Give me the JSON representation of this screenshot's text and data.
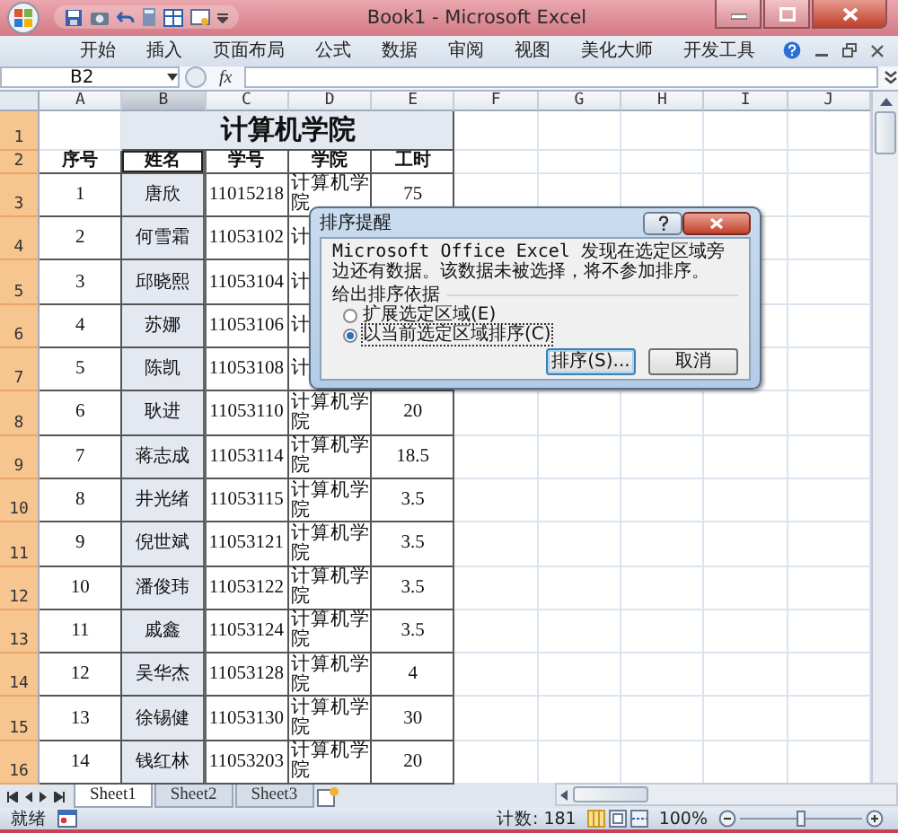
{
  "window": {
    "title": "Book1 - Microsoft Excel"
  },
  "ribbon_tabs": [
    "开始",
    "插入",
    "页面布局",
    "公式",
    "数据",
    "审阅",
    "视图",
    "美化大师",
    "开发工具"
  ],
  "formula_bar": {
    "name_box": "B2",
    "fx": "fx"
  },
  "columns": [
    {
      "label": "A",
      "selected": false
    },
    {
      "label": "B",
      "selected": true
    },
    {
      "label": "C",
      "selected": false
    },
    {
      "label": "D",
      "selected": false
    },
    {
      "label": "E",
      "selected": false
    },
    {
      "label": "F",
      "selected": false
    },
    {
      "label": "G",
      "selected": false
    },
    {
      "label": "H",
      "selected": false
    },
    {
      "label": "I",
      "selected": false
    },
    {
      "label": "J",
      "selected": false
    }
  ],
  "rows": [
    {
      "header": "1",
      "selected": true,
      "kind": "title",
      "cells": [
        "计算机学院"
      ]
    },
    {
      "header": "2",
      "selected": true,
      "kind": "header",
      "cells": [
        "序号",
        "姓名",
        "学号",
        "学院",
        "工时"
      ]
    },
    {
      "header": "3",
      "selected": true,
      "kind": "data",
      "cells": [
        "1",
        "唐欣",
        "11015218",
        "计算机学院",
        "75"
      ]
    },
    {
      "header": "4",
      "selected": true,
      "kind": "data",
      "cells": [
        "2",
        "何雪霜",
        "11053102",
        "计"
      ]
    },
    {
      "header": "5",
      "selected": true,
      "kind": "data",
      "cells": [
        "3",
        "邱晓熙",
        "11053104",
        "计"
      ]
    },
    {
      "header": "6",
      "selected": true,
      "kind": "data",
      "cells": [
        "4",
        "苏娜",
        "11053106",
        "计"
      ]
    },
    {
      "header": "7",
      "selected": true,
      "kind": "data",
      "cells": [
        "5",
        "陈凯",
        "11053108",
        "计"
      ]
    },
    {
      "header": "8",
      "selected": true,
      "kind": "data",
      "cells": [
        "6",
        "耿进",
        "11053110",
        "计算机学院",
        "20"
      ]
    },
    {
      "header": "9",
      "selected": true,
      "kind": "data",
      "cells": [
        "7",
        "蒋志成",
        "11053114",
        "计算机学院",
        "18.5"
      ]
    },
    {
      "header": "10",
      "selected": true,
      "kind": "data",
      "cells": [
        "8",
        "井光绪",
        "11053115",
        "计算机学院",
        "3.5"
      ]
    },
    {
      "header": "11",
      "selected": true,
      "kind": "data",
      "cells": [
        "9",
        "倪世斌",
        "11053121",
        "计算机学院",
        "3.5"
      ]
    },
    {
      "header": "12",
      "selected": true,
      "kind": "data",
      "cells": [
        "10",
        "潘俊玮",
        "11053122",
        "计算机学院",
        "3.5"
      ]
    },
    {
      "header": "13",
      "selected": true,
      "kind": "data",
      "cells": [
        "11",
        "戚鑫",
        "11053124",
        "计算机学院",
        "3.5"
      ]
    },
    {
      "header": "14",
      "selected": true,
      "kind": "data",
      "cells": [
        "12",
        "吴华杰",
        "11053128",
        "计算机学院",
        "4"
      ]
    },
    {
      "header": "15",
      "selected": true,
      "kind": "data",
      "cells": [
        "13",
        "徐锡健",
        "11053130",
        "计算机学院",
        "30"
      ]
    },
    {
      "header": "16",
      "selected": true,
      "kind": "data",
      "cells": [
        "14",
        "钱红林",
        "11053203",
        "计算机学院",
        "20"
      ]
    }
  ],
  "dialog": {
    "title": "排序提醒",
    "message": "Microsoft Office Excel 发现在选定区域旁边还有数据。该数据未被选择，将不参加排序。",
    "group_label": "给出排序依据",
    "options": [
      {
        "label": "扩展选定区域(E)",
        "selected": false
      },
      {
        "label": "以当前选定区域排序(C)",
        "selected": true
      }
    ],
    "buttons": [
      "排序(S)...",
      "取消"
    ]
  },
  "sheet_tabs": [
    {
      "label": "Sheet1",
      "selected": true
    },
    {
      "label": "Sheet2",
      "selected": false
    },
    {
      "label": "Sheet3",
      "selected": false
    }
  ],
  "status_bar": {
    "mode": "就绪",
    "count": "计数: 181",
    "zoom": "100%",
    "zoom_slider": {
      "level": 0.5
    }
  }
}
